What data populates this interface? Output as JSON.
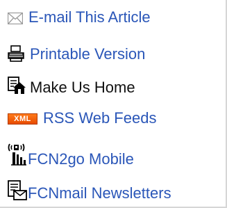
{
  "links": {
    "email": {
      "label": "E-mail This Article",
      "icon": "envelope-icon"
    },
    "print": {
      "label": "Printable Version",
      "icon": "printer-icon"
    },
    "home": {
      "label": "Make Us Home",
      "icon": "house-icon"
    },
    "rss": {
      "label": "RSS Web Feeds",
      "icon": "xml-rss-badge-icon",
      "badge_text": "XML",
      "badge_color": "#ff6a00"
    },
    "mobile": {
      "label": "FCN2go Mobile",
      "icon": "mobile-signal-icon"
    },
    "newsletters": {
      "label": "FCNmail Newsletters",
      "icon": "mail-document-icon"
    }
  },
  "colors": {
    "link": "#2a56b8",
    "text": "#111111",
    "border": "#d6d6d6"
  }
}
